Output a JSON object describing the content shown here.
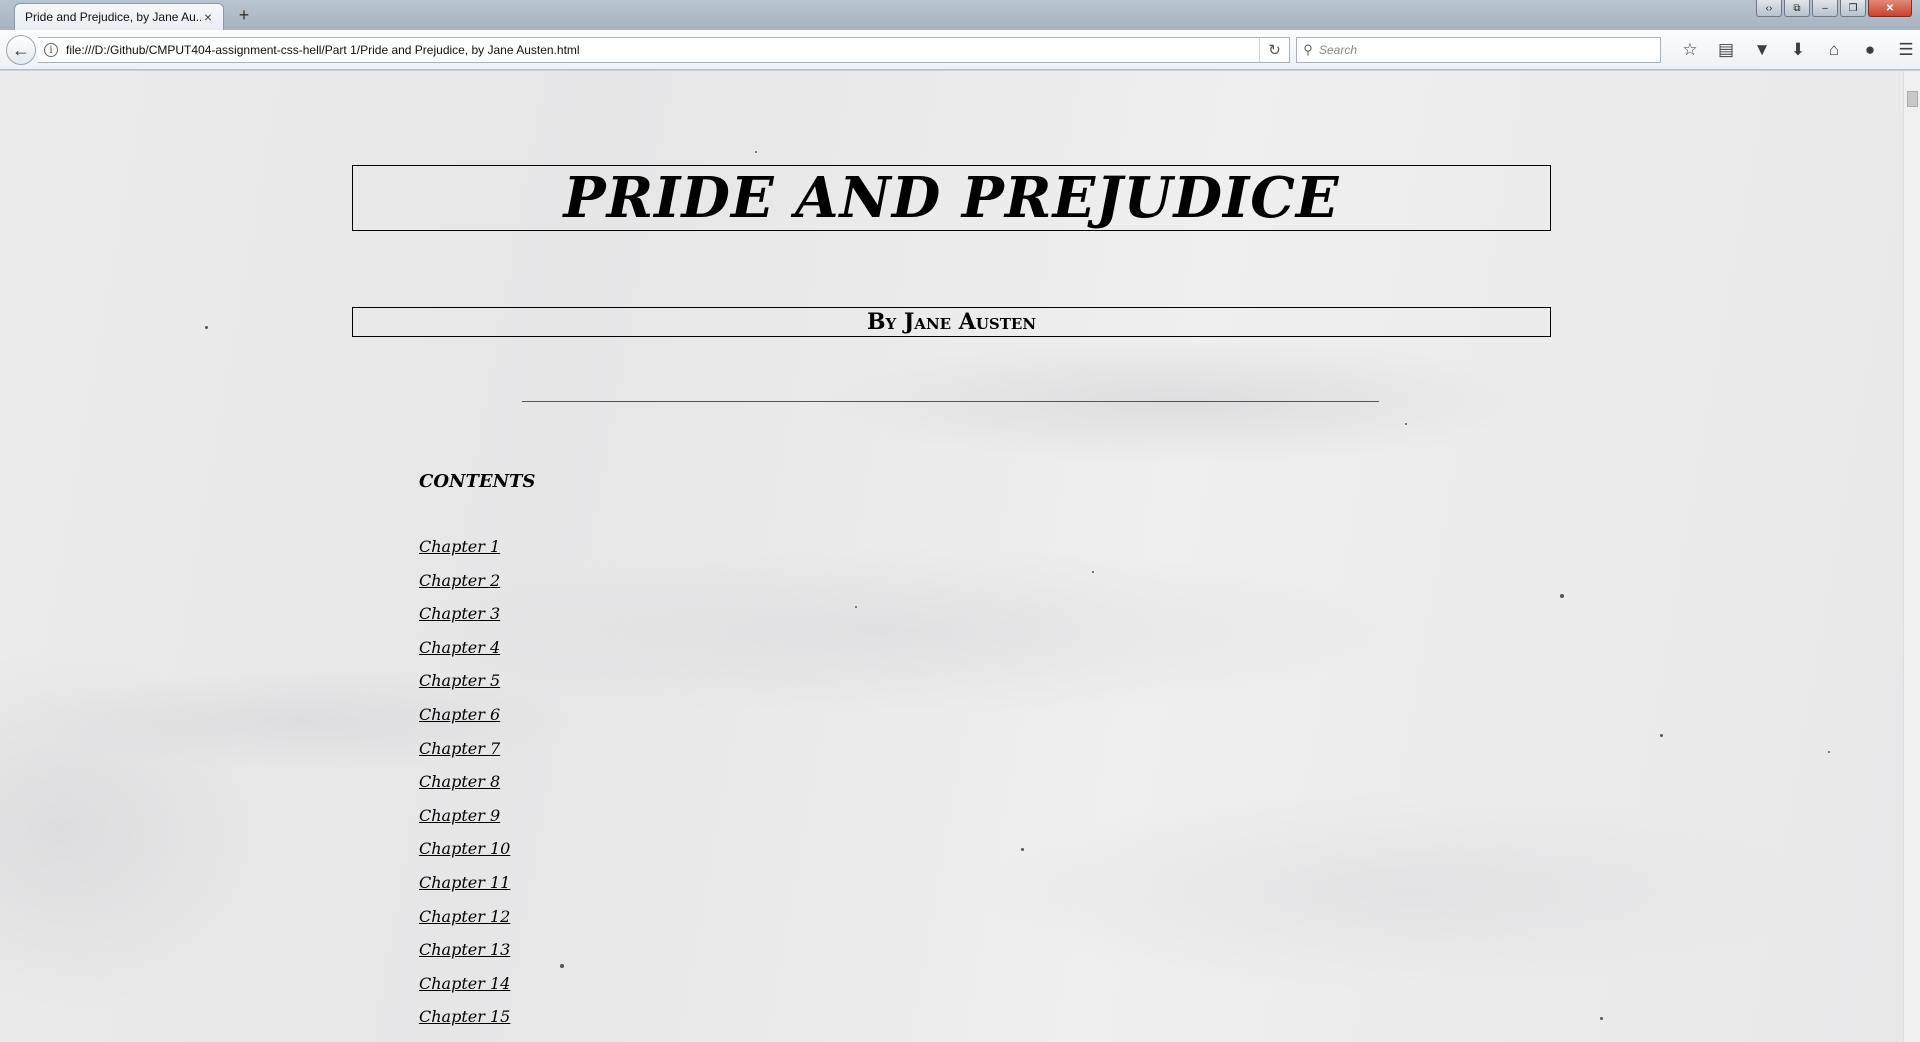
{
  "browser": {
    "tab_title": "Pride and Prejudice, by Jane Au...",
    "tab_close": "×",
    "new_tab": "+",
    "url": "file:///D:/Github/CMPUT404-assignment-css-hell/Part 1/Pride and Prejudice, by Jane Austen.html",
    "search_placeholder": "Search",
    "window_controls": [
      "‹›",
      "⧉",
      "–",
      "❐",
      "✕"
    ]
  },
  "page": {
    "title": "PRIDE AND PREJUDICE",
    "author": "By Jane Austen",
    "contents_heading": "CONTENTS",
    "chapters": [
      "Chapter 1",
      "Chapter 2",
      "Chapter 3",
      "Chapter 4",
      "Chapter 5",
      "Chapter 6",
      "Chapter 7",
      "Chapter 8",
      "Chapter 9",
      "Chapter 10",
      "Chapter 11",
      "Chapter 12",
      "Chapter 13",
      "Chapter 14",
      "Chapter 15"
    ]
  }
}
